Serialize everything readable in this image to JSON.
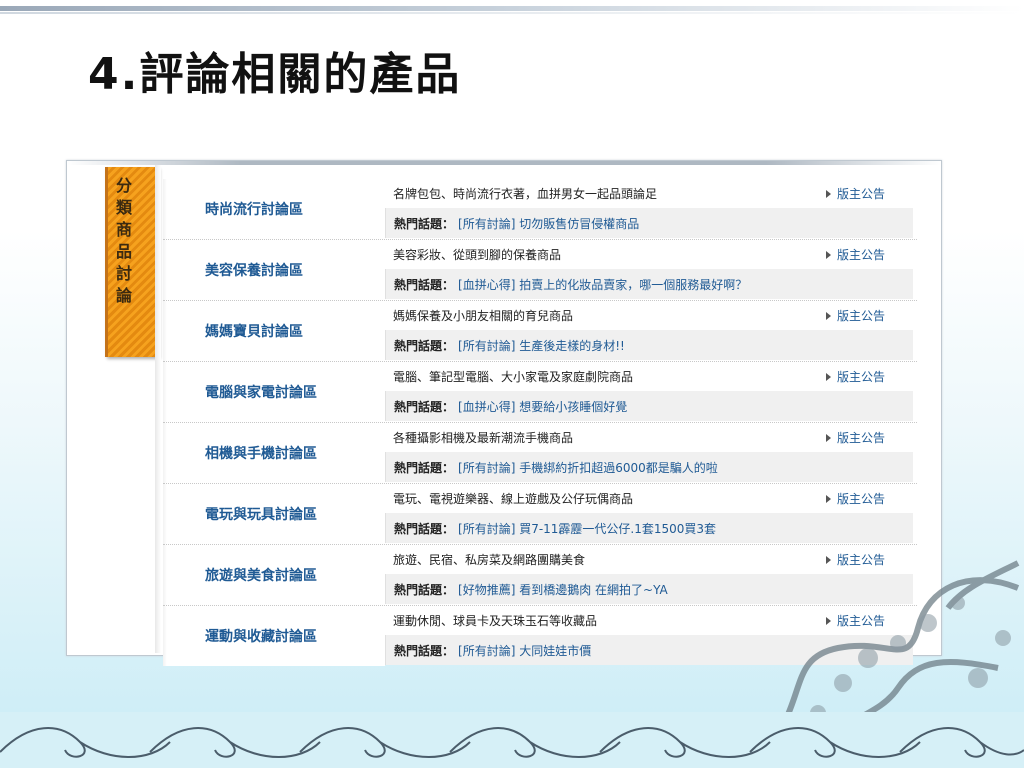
{
  "slide": {
    "title": "4.評論相關的產品"
  },
  "sidebar": {
    "label": [
      "分",
      "類",
      "商",
      "品",
      "討",
      "論"
    ]
  },
  "forum": {
    "hot_label": "熱門話題：",
    "notice_label": "版主公告",
    "categories": [
      {
        "name": "時尚流行討論區",
        "description": "名牌包包、時尚流行衣著，血拼男女一起品頭論足",
        "hot_topic": "[所有討論] 切勿販售仿冒侵權商品"
      },
      {
        "name": "美容保養討論區",
        "description": "美容彩妝、從頭到腳的保養商品",
        "hot_topic": "[血拼心得] 拍賣上的化妝品賣家，哪一個服務最好啊？"
      },
      {
        "name": "媽媽寶貝討論區",
        "description": "媽媽保養及小朋友相關的育兒商品",
        "hot_topic": "[所有討論] 生產後走樣的身材!!"
      },
      {
        "name": "電腦與家電討論區",
        "description": "電腦、筆記型電腦、大小家電及家庭劇院商品",
        "hot_topic": "[血拼心得] 想要給小孩睡個好覺"
      },
      {
        "name": "相機與手機討論區",
        "description": "各種攝影相機及最新潮流手機商品",
        "hot_topic": "[所有討論] 手機綁約折扣超過6000都是騙人的啦"
      },
      {
        "name": "電玩與玩具討論區",
        "description": "電玩、電視遊樂器、線上遊戲及公仔玩偶商品",
        "hot_topic": "[所有討論] 買7-11霹靂一代公仔.1套1500買3套"
      },
      {
        "name": "旅遊與美食討論區",
        "description": "旅遊、民宿、私房菜及網路團購美食",
        "hot_topic": "[好物推薦] 看到橋邊鵝肉 在網拍了~YA"
      },
      {
        "name": "運動與收藏討論區",
        "description": "運動休閒、球員卡及天珠玉石等收藏品",
        "hot_topic": "[所有討論] 大同娃娃市價"
      }
    ]
  },
  "colors": {
    "link": "#1f5a94",
    "ribbon": "#f6a21e",
    "hot_bg": "#f0f0f0"
  }
}
